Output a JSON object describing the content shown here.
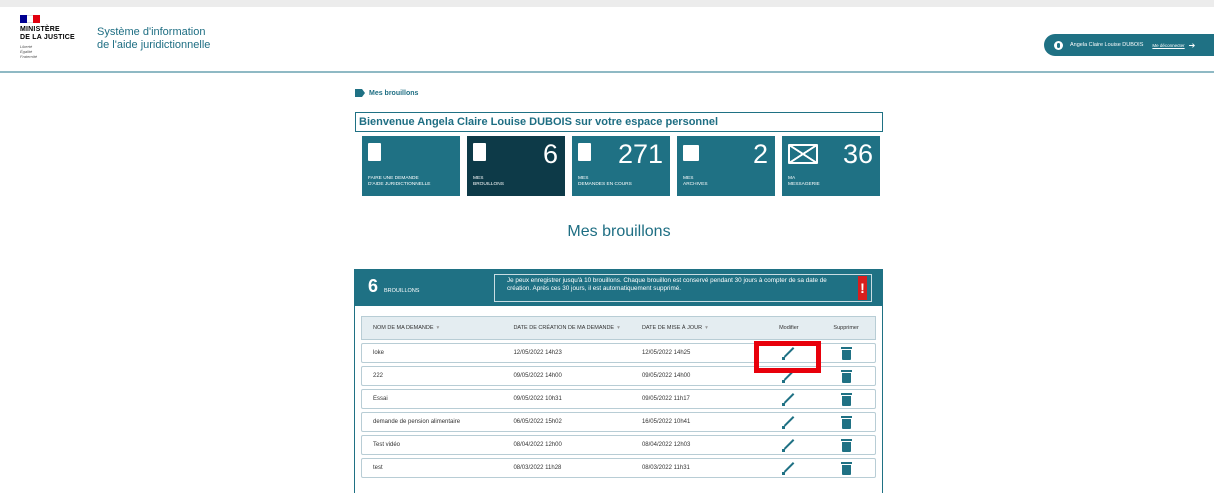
{
  "header": {
    "logo_title": "MINISTÈRE\nDE LA JUSTICE",
    "logo_motto": "Liberté\nÉgalité\nFraternité",
    "site_title": "Système d'information\nde l'aide juridictionnelle",
    "user_name": "Angela Claire Louise DUBOIS",
    "logout_label": "Me déconnecter",
    "flag_colors": [
      "#000091",
      "#ffffff",
      "#e1000f"
    ]
  },
  "breadcrumb": {
    "current": "Mes brouillons"
  },
  "welcome": "Bienvenue Angela Claire Louise DUBOIS sur votre espace personnel",
  "tiles": [
    {
      "icon": "document-icon",
      "count": "",
      "label": "FAIRE UNE DEMANDE\nD'AIDE JURIDICTIONNELLE",
      "active": false
    },
    {
      "icon": "edit-document-icon",
      "count": "6",
      "label": "MES\nBROUILLONS",
      "active": true
    },
    {
      "icon": "pending-document-icon",
      "count": "271",
      "label": "MES\nDEMANDES EN COURS",
      "active": false
    },
    {
      "icon": "archive-icon",
      "count": "2",
      "label": "MES\nARCHIVES",
      "active": false
    },
    {
      "icon": "mail-icon",
      "count": "36",
      "label": "MA\nMESSAGERIE",
      "active": false
    }
  ],
  "section_title": "Mes brouillons",
  "drafts": {
    "count": "6",
    "count_label": "BROUILLONS",
    "notice": "Je peux enregistrer jusqu'à 10 brouillons. Chaque brouillon est conservé pendant 30 jours à compter de sa date de création. Après ces 30 jours, il est automatiquement supprimé.",
    "alert_symbol": "!",
    "columns": {
      "name": "NOM DE MA DEMANDE",
      "created": "DATE DE CRÉATION DE MA DEMANDE",
      "updated": "DATE DE MISE À JOUR",
      "edit": "Modifier",
      "delete": "Supprimer"
    },
    "rows": [
      {
        "name": "loke",
        "created": "12/05/2022 14h23",
        "updated": "12/05/2022 14h25"
      },
      {
        "name": "222",
        "created": "09/05/2022 14h00",
        "updated": "09/05/2022 14h00"
      },
      {
        "name": "Essai",
        "created": "09/05/2022 10h31",
        "updated": "09/05/2022 11h17"
      },
      {
        "name": "demande de pension alimentaire",
        "created": "06/05/2022 15h02",
        "updated": "16/05/2022 10h41"
      },
      {
        "name": "Test vidéo",
        "created": "08/04/2022 12h00",
        "updated": "08/04/2022 12h03"
      },
      {
        "name": "test",
        "created": "08/03/2022 11h28",
        "updated": "08/03/2022 11h31"
      }
    ]
  },
  "colors": {
    "primary": "#1f7184",
    "active_tile": "#0d3a48",
    "highlight": "#e8000b",
    "alert": "#d81e1e"
  }
}
